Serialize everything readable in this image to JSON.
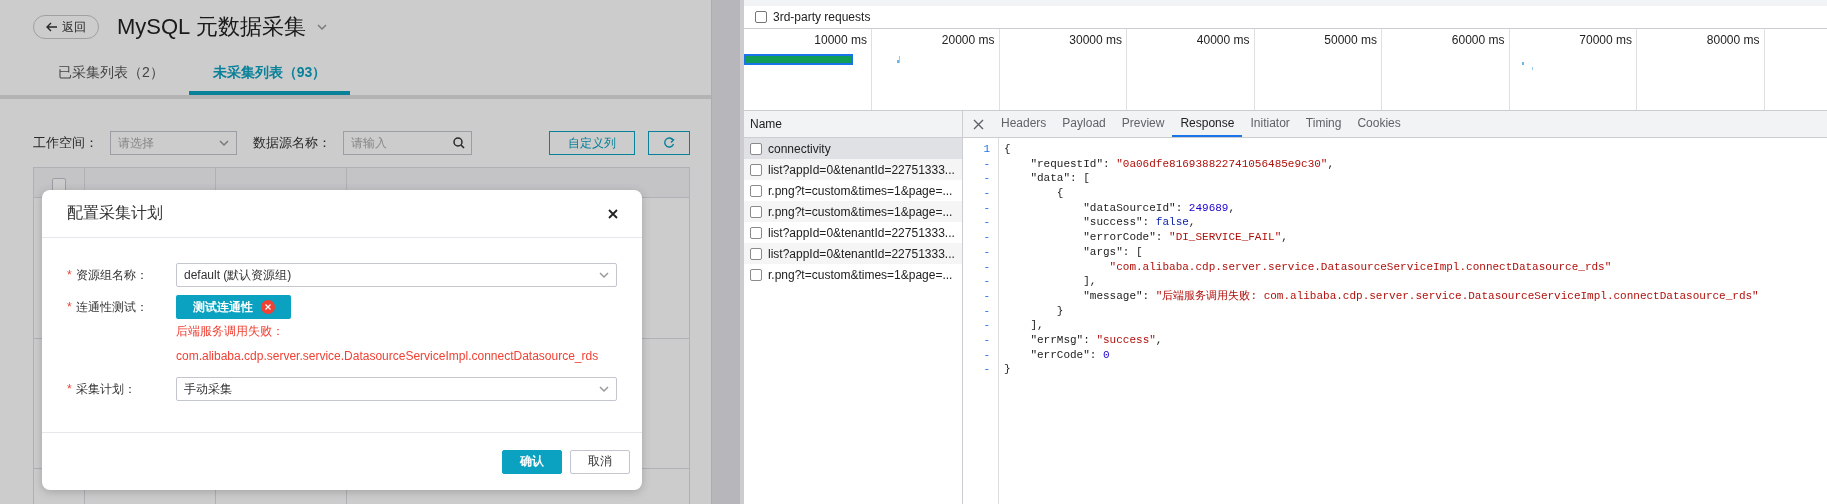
{
  "app": {
    "back_button": "返回",
    "title": "MySQL 元数据采集",
    "tabs": [
      {
        "label": "已采集列表（2）",
        "selected": false
      },
      {
        "label": "未采集列表（93）",
        "selected": true
      }
    ],
    "filters": [
      {
        "kind": "select",
        "label": "工作空间：",
        "placeholder": "请选择"
      },
      {
        "kind": "search",
        "label": "数据源名称：",
        "placeholder": "请输入"
      }
    ],
    "custom_columns_button": "自定义列",
    "table": {
      "select_all": {
        "checked": false
      }
    }
  },
  "dialog": {
    "title": "配置采集计划",
    "fields": [
      {
        "kind": "select",
        "required_mark": "*",
        "label": "资源组名称：",
        "value": "default (默认资源组)"
      },
      {
        "kind": "test",
        "required_mark": "*",
        "label": "连通性测试：",
        "button": "测试连通性",
        "failed": true,
        "error_lines": [
          "后端服务调用失败：",
          "com.alibaba.cdp.server.service.DatasourceServiceImpl.connectDatasource_rds"
        ]
      },
      {
        "kind": "select",
        "required_mark": "*",
        "label": "采集计划：",
        "value": "手动采集"
      }
    ],
    "buttons": [
      {
        "label": "确认",
        "primary": true
      },
      {
        "label": "取消",
        "primary": false
      }
    ]
  },
  "devtools": {
    "third_party_requests": {
      "label": "3rd-party requests",
      "checked": false
    },
    "timeline_ticks": [
      "10000 ms",
      "20000 ms",
      "30000 ms",
      "40000 ms",
      "50000 ms",
      "60000 ms",
      "70000 ms",
      "80000 ms"
    ],
    "requests": {
      "column": "Name",
      "rows": [
        {
          "name": "connectivity",
          "selected": true
        },
        {
          "name": "list?appId=0&tenantId=22751333...",
          "selected": false
        },
        {
          "name": "r.png?t=custom&times=1&page=...",
          "selected": false
        },
        {
          "name": "r.png?t=custom&times=1&page=...",
          "selected": false
        },
        {
          "name": "list?appId=0&tenantId=22751333...",
          "selected": false
        },
        {
          "name": "list?appId=0&tenantId=22751333...",
          "selected": false
        },
        {
          "name": "r.png?t=custom&times=1&page=...",
          "selected": false
        }
      ]
    },
    "tabs": [
      {
        "label": "Headers",
        "selected": false
      },
      {
        "label": "Payload",
        "selected": false
      },
      {
        "label": "Preview",
        "selected": false
      },
      {
        "label": "Response",
        "selected": true
      },
      {
        "label": "Initiator",
        "selected": false
      },
      {
        "label": "Timing",
        "selected": false
      },
      {
        "label": "Cookies",
        "selected": false
      }
    ],
    "response_lines": [
      {
        "gutter": "1",
        "tokens": [
          {
            "kind": "plain",
            "text": "{"
          }
        ]
      },
      {
        "gutter": "-",
        "tokens": [
          {
            "kind": "plain",
            "text": "    \"requestId\": "
          },
          {
            "kind": "string",
            "text": "\"0a06dfe816938822741056485e9c30\""
          },
          {
            "kind": "plain",
            "text": ","
          }
        ]
      },
      {
        "gutter": "-",
        "tokens": [
          {
            "kind": "plain",
            "text": "    \"data\": ["
          }
        ]
      },
      {
        "gutter": "-",
        "tokens": [
          {
            "kind": "plain",
            "text": "        {"
          }
        ]
      },
      {
        "gutter": "-",
        "tokens": [
          {
            "kind": "plain",
            "text": "            \"dataSourceId\": "
          },
          {
            "kind": "number",
            "text": "249689"
          },
          {
            "kind": "plain",
            "text": ","
          }
        ]
      },
      {
        "gutter": "-",
        "tokens": [
          {
            "kind": "plain",
            "text": "            \"success\": "
          },
          {
            "kind": "literal",
            "text": "false"
          },
          {
            "kind": "plain",
            "text": ","
          }
        ]
      },
      {
        "gutter": "-",
        "tokens": [
          {
            "kind": "plain",
            "text": "            \"errorCode\": "
          },
          {
            "kind": "string",
            "text": "\"DI_SERVICE_FAIL\""
          },
          {
            "kind": "plain",
            "text": ","
          }
        ]
      },
      {
        "gutter": "-",
        "tokens": [
          {
            "kind": "plain",
            "text": "            \"args\": ["
          }
        ]
      },
      {
        "gutter": "-",
        "tokens": [
          {
            "kind": "string",
            "text": "                \"com.alibaba.cdp.server.service.DatasourceServiceImpl.connectDatasource_rds\""
          }
        ]
      },
      {
        "gutter": "-",
        "tokens": [
          {
            "kind": "plain",
            "text": "            ],"
          }
        ]
      },
      {
        "gutter": "-",
        "tokens": [
          {
            "kind": "plain",
            "text": "            \"message\": "
          },
          {
            "kind": "string",
            "text": "\"后端服务调用失败: com.alibaba.cdp.server.service.DatasourceServiceImpl.connectDatasource_rds\""
          }
        ]
      },
      {
        "gutter": "-",
        "tokens": [
          {
            "kind": "plain",
            "text": "        }"
          }
        ]
      },
      {
        "gutter": "-",
        "tokens": [
          {
            "kind": "plain",
            "text": "    ],"
          }
        ]
      },
      {
        "gutter": "-",
        "tokens": [
          {
            "kind": "plain",
            "text": "    \"errMsg\": "
          },
          {
            "kind": "string",
            "text": "\"success\""
          },
          {
            "kind": "plain",
            "text": ","
          }
        ]
      },
      {
        "gutter": "-",
        "tokens": [
          {
            "kind": "plain",
            "text": "    \"errCode\": "
          },
          {
            "kind": "number",
            "text": "0"
          }
        ]
      },
      {
        "gutter": "-",
        "tokens": [
          {
            "kind": "plain",
            "text": "}"
          }
        ]
      }
    ]
  }
}
